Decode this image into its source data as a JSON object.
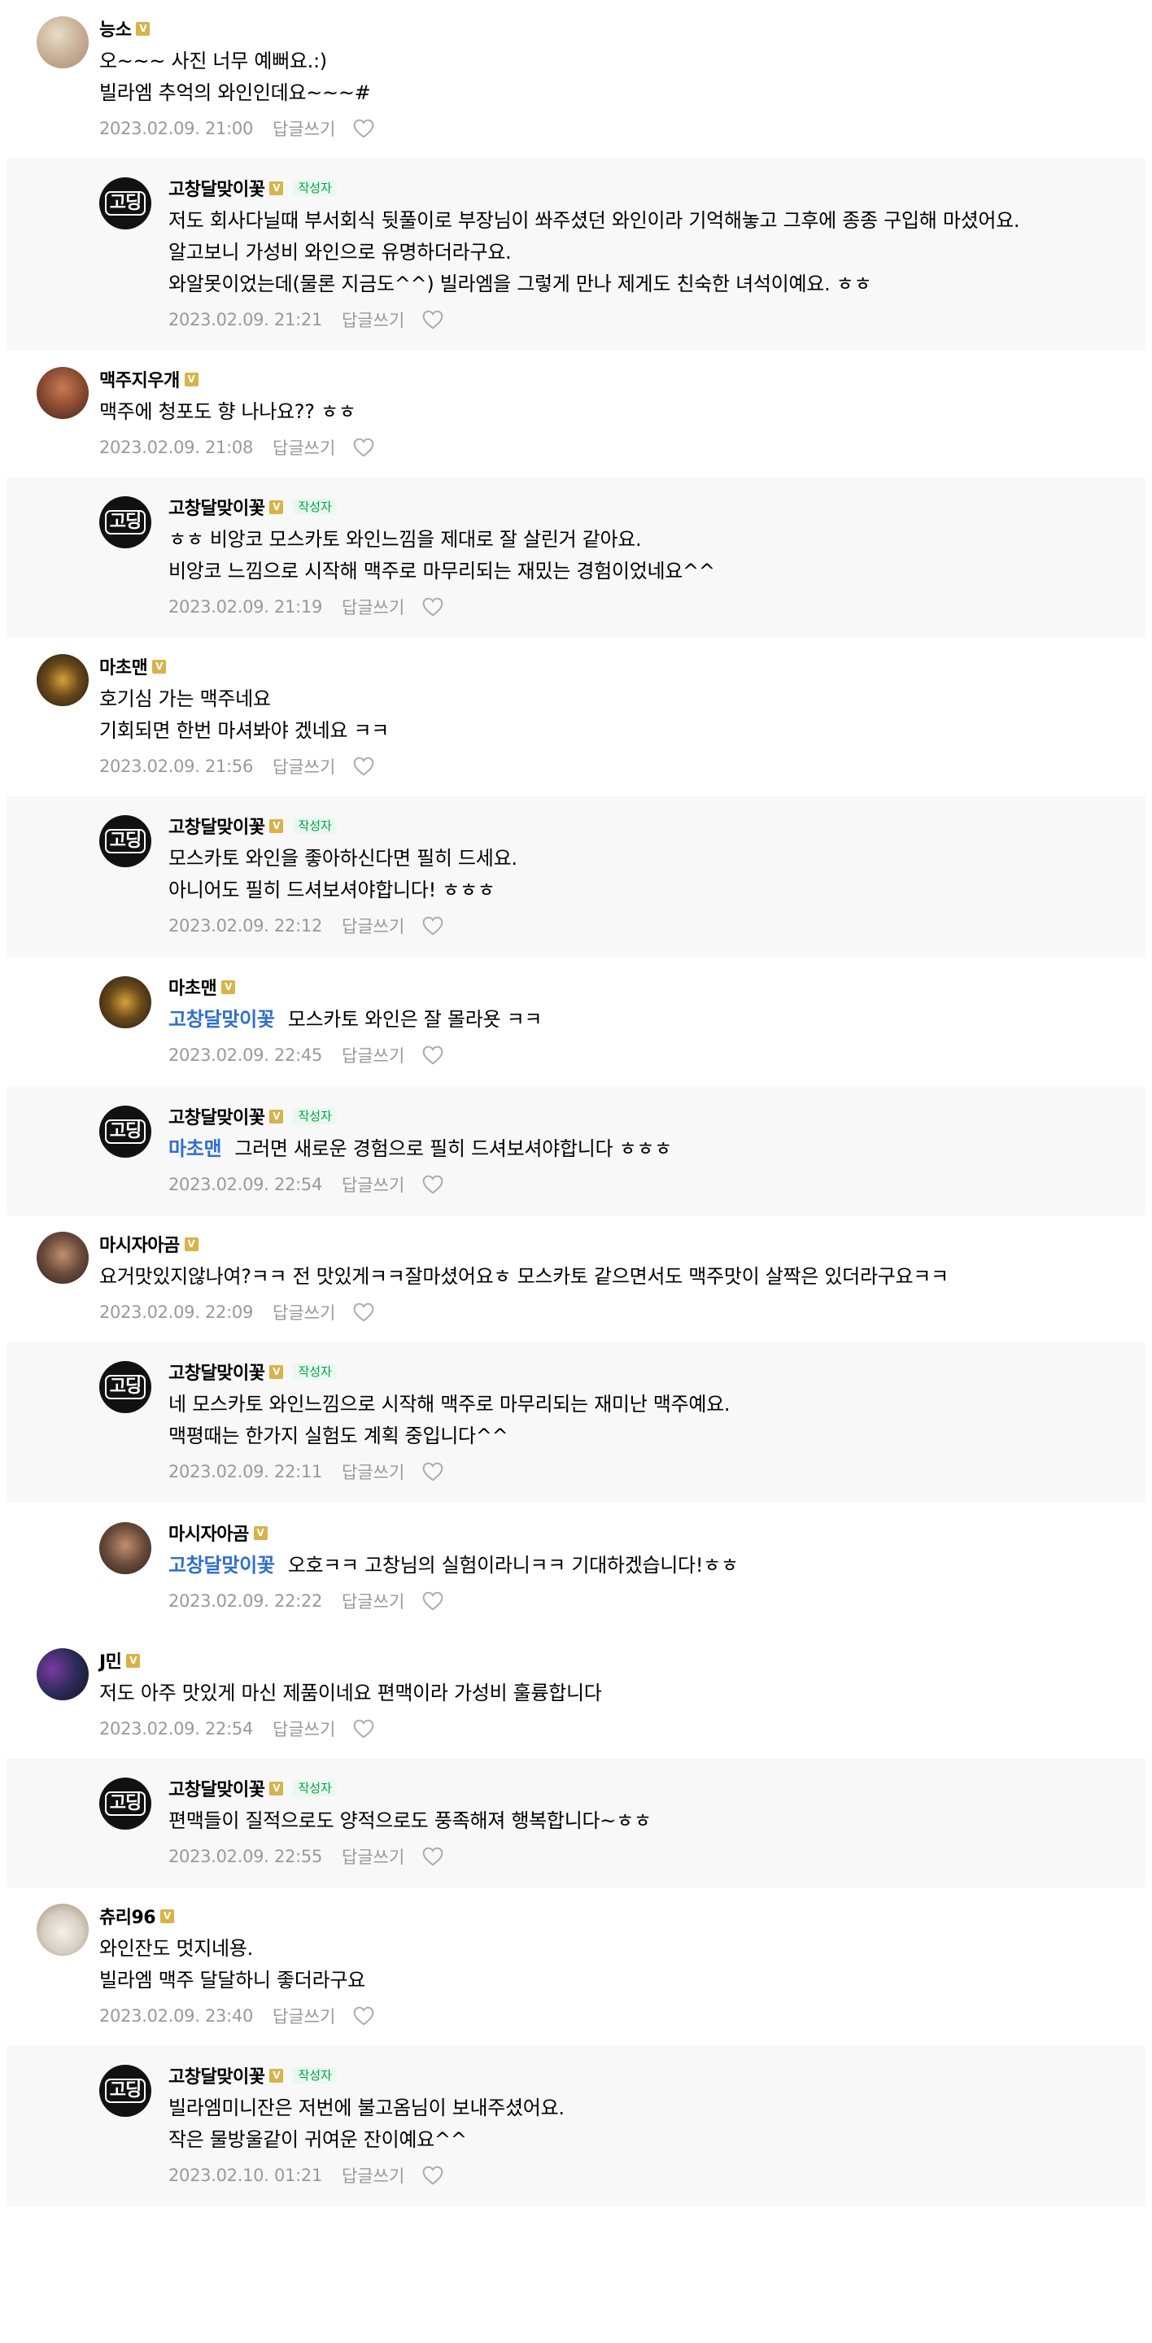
{
  "labels": {
    "reply": "답글쓰기",
    "author_tag": "작성자"
  },
  "comments": [
    {
      "type": "top",
      "avatar": "photo-1",
      "nick": "능소",
      "text": "오~~~ 사진 너무 예뻐요.:)\n빌라엠 추억의 와인인데요~~~#",
      "date": "2023.02.09. 21:00"
    },
    {
      "type": "reply",
      "avatar": "author",
      "nick": "고창달맞이꽃",
      "author": true,
      "text": "저도 회사다닐때 부서회식 뒷풀이로 부장님이 쏴주셨던 와인이라 기억해놓고 그후에 종종 구입해 마셨어요.\n알고보니 가성비 와인으로 유명하더라구요.\n와알못이었는데(물론 지금도^^) 빌라엠을 그렇게 만나 제게도 친숙한 녀석이예요. ㅎㅎ",
      "date": "2023.02.09. 21:21"
    },
    {
      "type": "top",
      "avatar": "photo-2",
      "nick": "맥주지우개",
      "text": "맥주에 청포도 향 나나요?? ㅎㅎ",
      "date": "2023.02.09. 21:08"
    },
    {
      "type": "reply",
      "avatar": "author",
      "nick": "고창달맞이꽃",
      "author": true,
      "text": "ㅎㅎ 비앙코 모스카토 와인느낌을 제대로 잘 살린거 같아요.\n비앙코 느낌으로 시작해 맥주로 마무리되는 재밌는 경험이었네요^^",
      "date": "2023.02.09. 21:19"
    },
    {
      "type": "top",
      "avatar": "photo-3",
      "nick": "마초맨",
      "text": "호기심 가는 맥주네요\n기회되면 한번 마셔봐야 겠네요 ㅋㅋ",
      "date": "2023.02.09. 21:56"
    },
    {
      "type": "reply",
      "avatar": "author",
      "nick": "고창달맞이꽃",
      "author": true,
      "text": "모스카토 와인을 좋아하신다면 필히 드세요.\n아니어도 필히 드셔보셔야합니다! ㅎㅎㅎ",
      "date": "2023.02.09. 22:12"
    },
    {
      "type": "reply",
      "avatar": "photo-3",
      "nick": "마초맨",
      "mention": "고창달맞이꽃",
      "text": "모스카토 와인은 잘 몰라욧 ㅋㅋ",
      "date": "2023.02.09. 22:45",
      "white": true
    },
    {
      "type": "reply",
      "avatar": "author",
      "nick": "고창달맞이꽃",
      "author": true,
      "mention": "마초맨",
      "text": "그러면 새로운 경험으로 필히 드셔보셔야합니다 ㅎㅎㅎ",
      "date": "2023.02.09. 22:54"
    },
    {
      "type": "top",
      "avatar": "photo-4",
      "nick": "마시자아곰",
      "text": "요거맛있지않나여?ㅋㅋ 전 맛있게ㅋㅋ잘마셨어요ㅎ 모스카토 같으면서도 맥주맛이 살짝은 있더라구요ㅋㅋ",
      "date": "2023.02.09. 22:09"
    },
    {
      "type": "reply",
      "avatar": "author",
      "nick": "고창달맞이꽃",
      "author": true,
      "text": "네 모스카토 와인느낌으로 시작해 맥주로 마무리되는 재미난 맥주예요.\n맥평때는 한가지 실험도 계획 중입니다^^",
      "date": "2023.02.09. 22:11"
    },
    {
      "type": "reply",
      "avatar": "photo-4",
      "nick": "마시자아곰",
      "mention": "고창달맞이꽃",
      "text": "오호ㅋㅋ 고창님의 실험이라니ㅋㅋ 기대하겠습니다!ㅎㅎ",
      "date": "2023.02.09. 22:22",
      "white": true
    },
    {
      "type": "top",
      "avatar": "photo-5",
      "nick": "J민",
      "text": "저도 아주 맛있게 마신 제품이네요 편맥이라 가성비 훌륭합니다",
      "date": "2023.02.09. 22:54"
    },
    {
      "type": "reply",
      "avatar": "author",
      "nick": "고창달맞이꽃",
      "author": true,
      "text": "편맥들이 질적으로도 양적으로도 풍족해져 행복합니다~ㅎㅎ",
      "date": "2023.02.09. 22:55"
    },
    {
      "type": "top",
      "avatar": "photo-6",
      "nick": "츄리96",
      "text": "와인잔도 멋지네용.\n빌라엠 맥주 달달하니 좋더라구요",
      "date": "2023.02.09. 23:40"
    },
    {
      "type": "reply",
      "avatar": "author",
      "nick": "고창달맞이꽃",
      "author": true,
      "text": "빌라엠미니잔은 저번에 불고옴님이 보내주셨어요.\n작은 물방울같이 귀여운 잔이예요^^",
      "date": "2023.02.10. 01:21"
    }
  ]
}
